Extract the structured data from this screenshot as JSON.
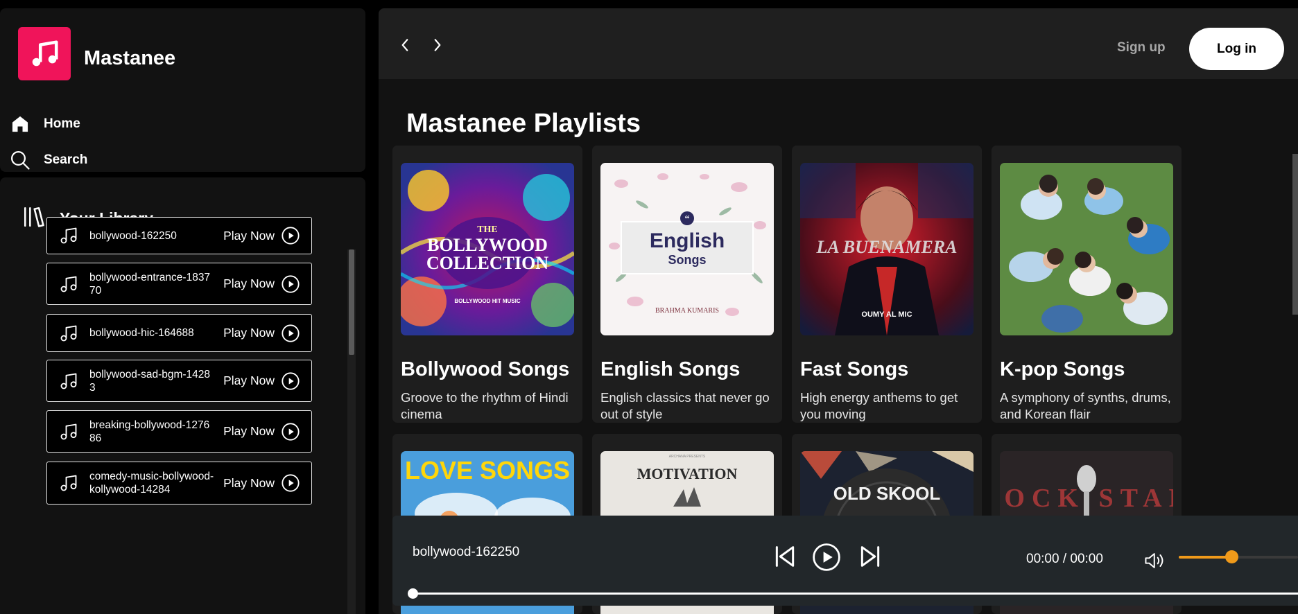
{
  "brand": {
    "name": "Mastanee",
    "accent": "#f0145a",
    "logo_icon": "music-note-icon"
  },
  "nav": [
    {
      "label": "Home",
      "icon": "home-icon"
    },
    {
      "label": "Search",
      "icon": "search-icon"
    }
  ],
  "library": {
    "title": "Your Library",
    "icon": "library-icon",
    "tracks": [
      {
        "name": "bollywood-162250",
        "action": "Play Now"
      },
      {
        "name": "bollywood-entrance-183770",
        "action": "Play Now"
      },
      {
        "name": "bollywood-hic-164688",
        "action": "Play Now"
      },
      {
        "name": "bollywood-sad-bgm-14283",
        "action": "Play Now"
      },
      {
        "name": "breaking-bollywood-127686",
        "action": "Play Now"
      },
      {
        "name": "comedy-music-bollywood-kollywood-14284",
        "action": "Play Now"
      }
    ]
  },
  "header": {
    "signup": "Sign up",
    "login": "Log in"
  },
  "main": {
    "title": "Mastanee Playlists",
    "playlists": [
      {
        "title": "Bollywood Songs",
        "desc": "Groove to the rhythm of Hindi cinema",
        "art_text": [
          "THE",
          "BOLLYWOOD",
          "COLLECTION",
          "BOLLYWOOD HIT MUSIC"
        ]
      },
      {
        "title": "English Songs",
        "desc": "English classics that never go out of style",
        "art_text": [
          "English",
          "Songs",
          "BRAHMA KUMARIS"
        ]
      },
      {
        "title": "Fast Songs",
        "desc": "High energy anthems to get you moving",
        "art_text": [
          "LA BUENAMERA",
          "OUMY AL MIC"
        ]
      },
      {
        "title": "K-pop Songs",
        "desc": "A symphony of synths, drums, and Korean flair",
        "art_text": []
      }
    ],
    "playlists_row2": [
      {
        "art_text": "LOVE SONGS"
      },
      {
        "art_text": "MOTIVATION"
      },
      {
        "art_text": "OLD SKOOL"
      },
      {
        "art_text": "ROCK STAR"
      }
    ]
  },
  "player": {
    "now_playing": "bollywood-162250",
    "time": "00:00 / 00:00",
    "volume": 0.44,
    "progress": 0,
    "accent": "#f09a1a"
  }
}
